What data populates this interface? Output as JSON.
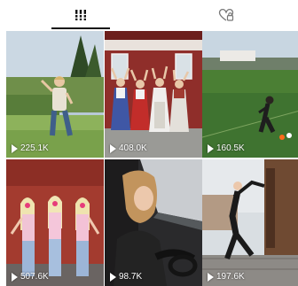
{
  "tabs": [
    {
      "icon": "grid-icon",
      "selected": true
    },
    {
      "icon": "liked-heart-icon",
      "selected": false
    }
  ],
  "videos": [
    {
      "views": "225.1K"
    },
    {
      "views": "408.0K"
    },
    {
      "views": "160.5K"
    },
    {
      "views": "507.6K"
    },
    {
      "views": "98.7K"
    },
    {
      "views": "197.6K"
    }
  ]
}
